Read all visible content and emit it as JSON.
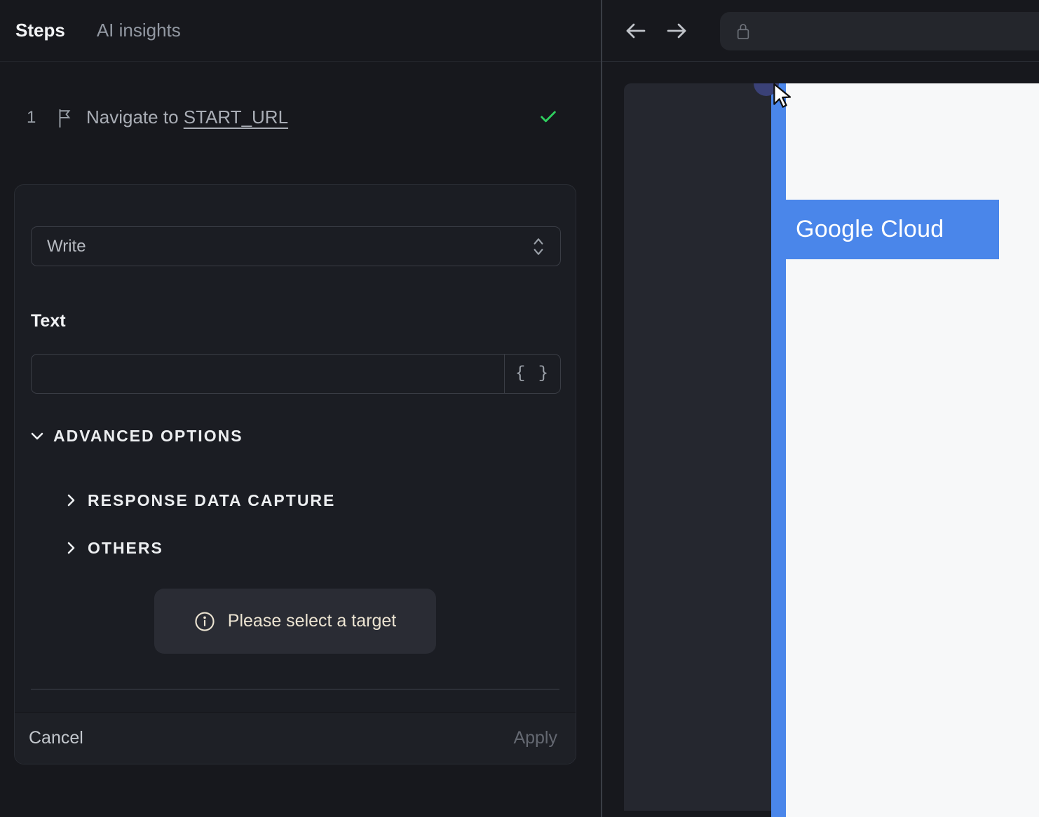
{
  "left_panel": {
    "tabs": [
      {
        "label": "Steps",
        "active": true
      },
      {
        "label": "AI insights",
        "active": false
      }
    ],
    "step": {
      "index": "1",
      "title_prefix": "Navigate to ",
      "title_link": "START_URL",
      "status": "success"
    },
    "editor": {
      "action_select": {
        "value": "Write"
      },
      "text_field": {
        "label": "Text",
        "value": "",
        "placeholder": ""
      },
      "advanced_options": {
        "label": "ADVANCED OPTIONS",
        "expanded": true,
        "sections": [
          {
            "label": "RESPONSE DATA CAPTURE",
            "expanded": false
          },
          {
            "label": "OTHERS",
            "expanded": false
          }
        ]
      },
      "notice": {
        "text": "Please select a target"
      },
      "footer": {
        "cancel_label": "Cancel",
        "apply_label": "Apply",
        "apply_enabled": false
      }
    }
  },
  "browser_panel": {
    "toolbar": {
      "address_value": ""
    },
    "page": {
      "highlight_label": "Google Cloud"
    }
  },
  "icons": {
    "braces": "{ }"
  },
  "colors": {
    "bg": "#17181d",
    "panel_card": "#1b1d23",
    "card_border": "#2a2d34",
    "field_border": "#3a3d45",
    "text_primary": "#f2f3f5",
    "text_secondary": "#a9adb5",
    "text_muted": "#9298a2",
    "accent_blue": "#4a86ea",
    "success_green": "#2fcf5f",
    "notice_bg": "#2a2c34",
    "notice_text": "#ece4d2",
    "footer_bg": "#1e2026",
    "browser_field_bg": "#24262c",
    "overlay_panel_bg": "#25272f",
    "page_white": "#f7f8f9",
    "selection_dot": "#3a4177"
  }
}
